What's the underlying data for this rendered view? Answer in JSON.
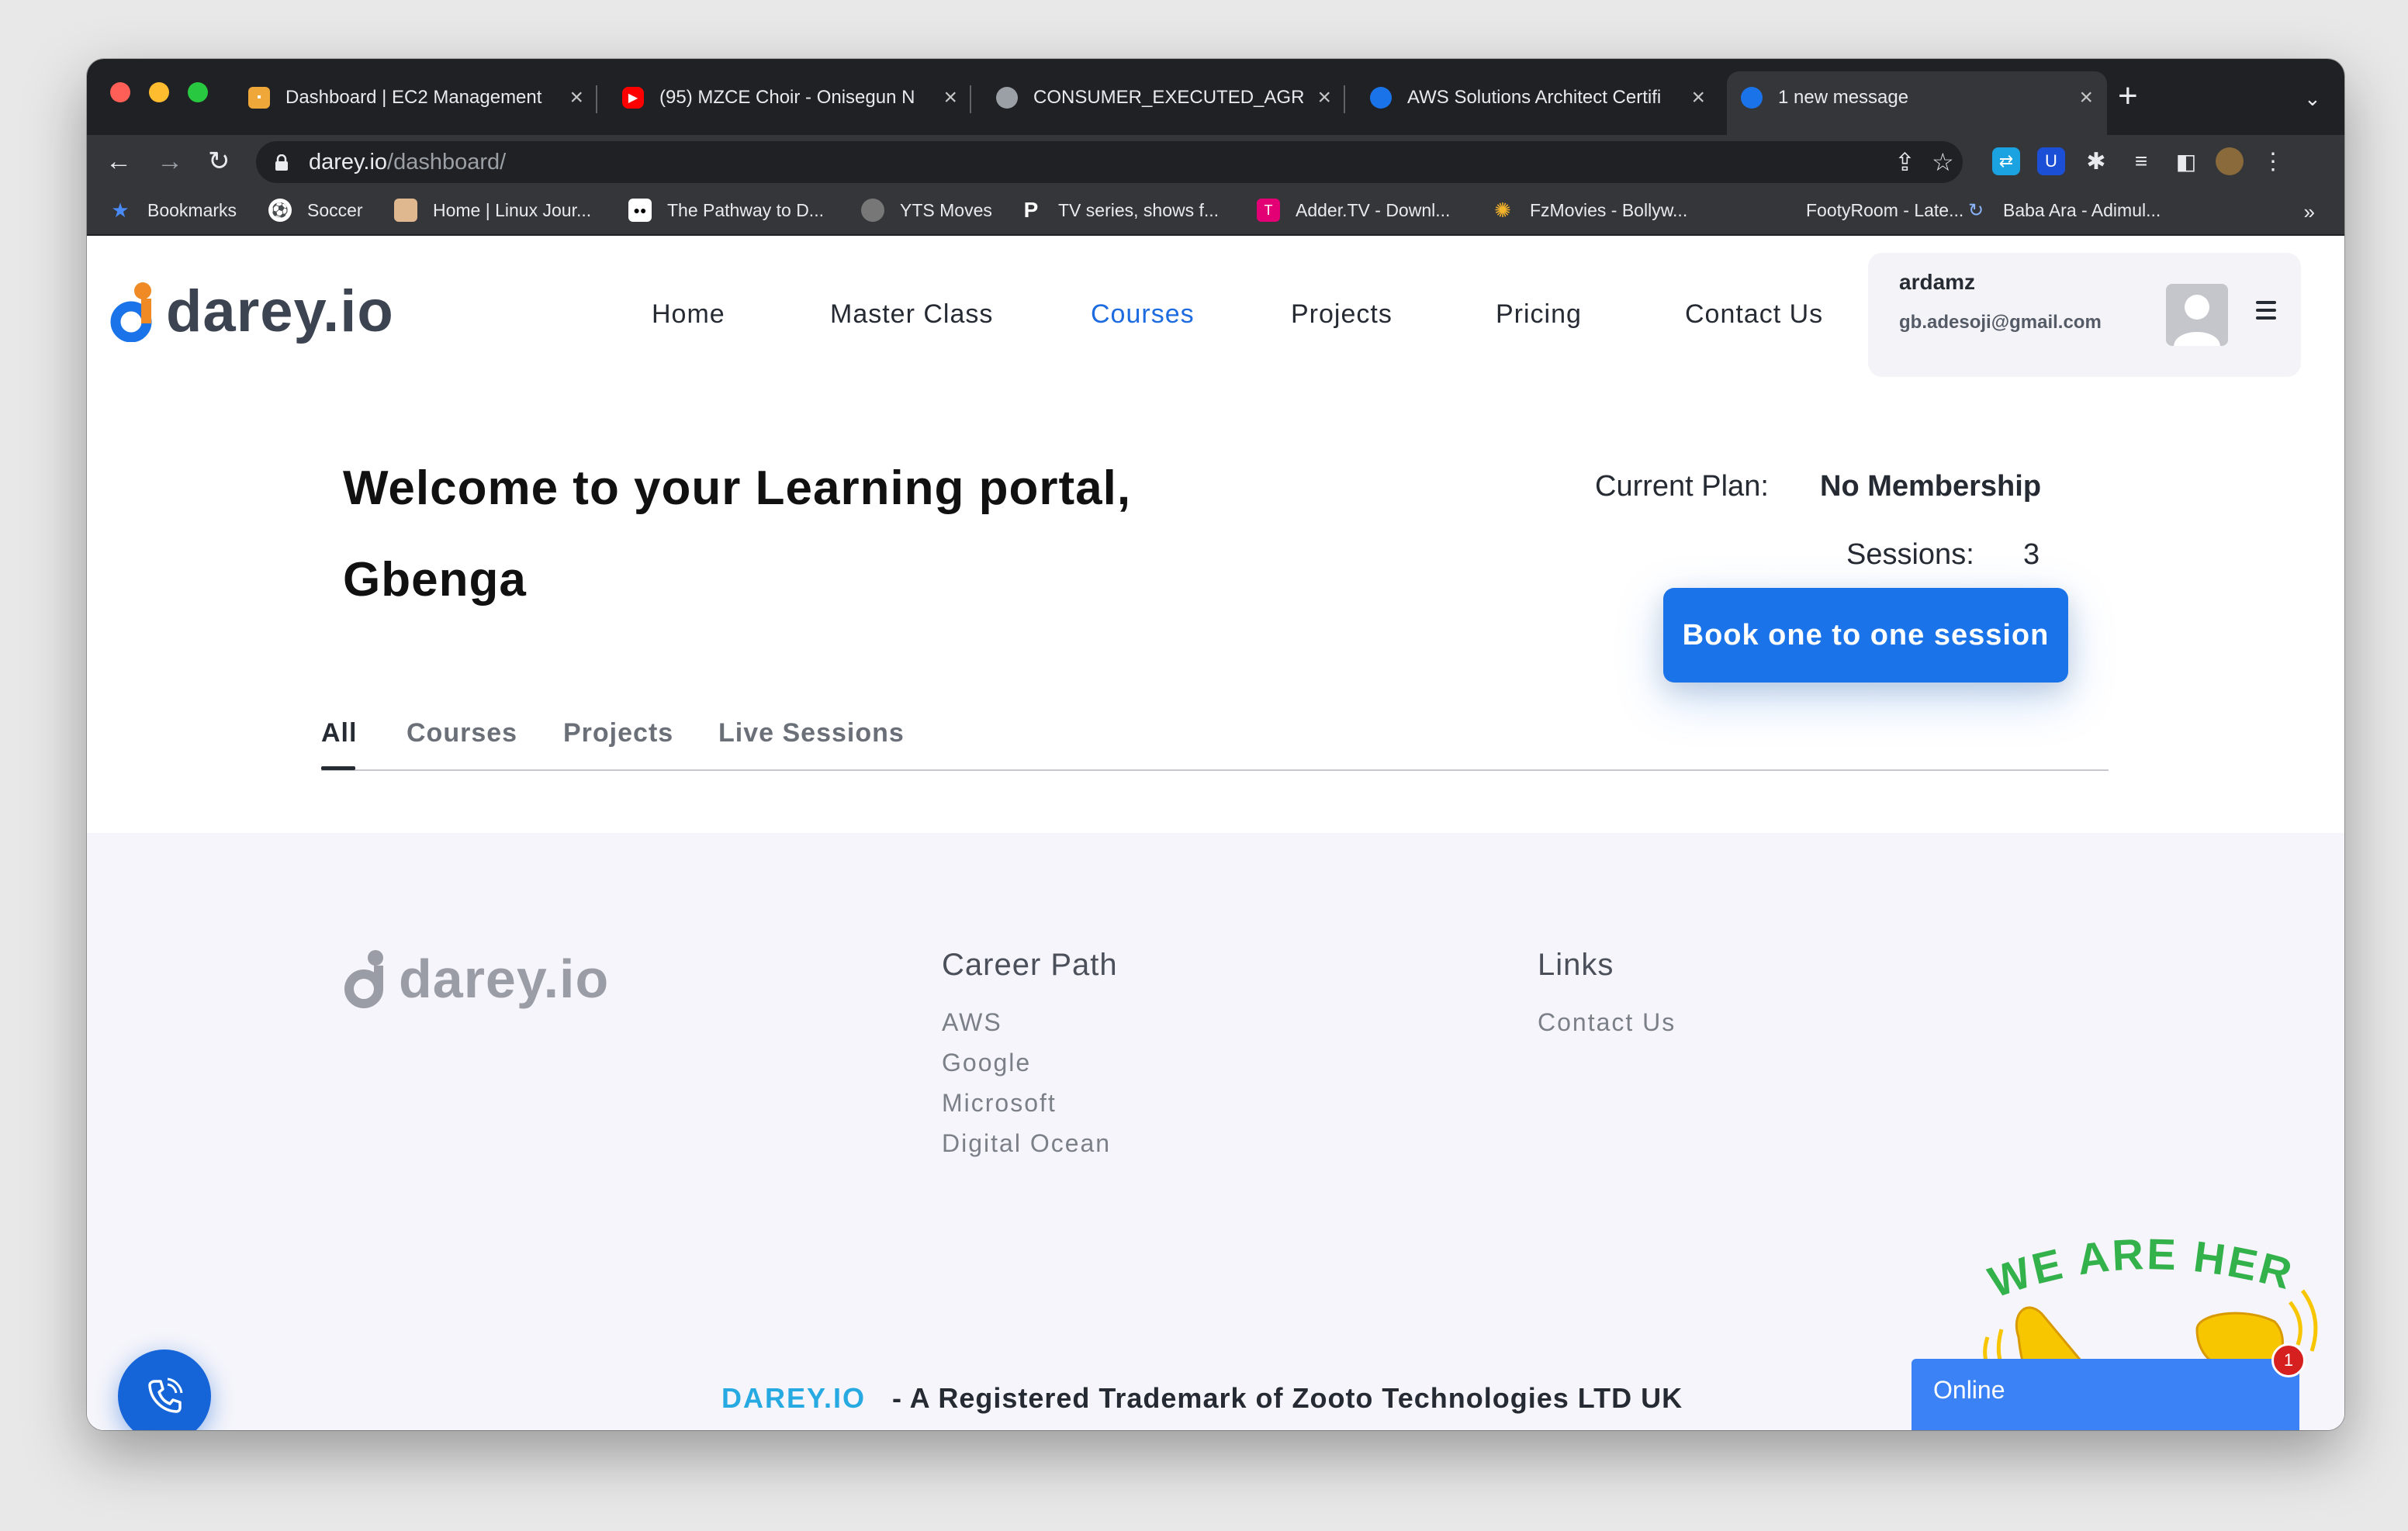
{
  "browser": {
    "tabs": [
      {
        "title": "Dashboard | EC2 Management",
        "favicon": "aws-box-icon",
        "color": "#f0a73a"
      },
      {
        "title": "(95) MZCE Choir - Onisegun N",
        "favicon": "youtube-icon",
        "color": "#ff0000"
      },
      {
        "title": "CONSUMER_EXECUTED_AGRE",
        "favicon": "globe-icon",
        "color": "#9aa0a6"
      },
      {
        "title": "AWS Solutions Architect Certifi",
        "favicon": "darey-icon",
        "color": "#1a73e8"
      },
      {
        "title": "1 new message",
        "favicon": "darey-icon",
        "color": "#1a73e8"
      }
    ],
    "url_domain": "darey.io",
    "url_path": "/dashboard/",
    "bookmarks": [
      {
        "label": "Bookmarks"
      },
      {
        "label": "Soccer"
      },
      {
        "label": "Home | Linux Jour..."
      },
      {
        "label": "The Pathway to D..."
      },
      {
        "label": "YTS Moves"
      },
      {
        "label": "TV series, shows f..."
      },
      {
        "label": "Adder.TV - Downl..."
      },
      {
        "label": "FzMovies - Bollyw..."
      },
      {
        "label": "FootyRoom - Late..."
      },
      {
        "label": "Baba Ara - Adimul..."
      }
    ],
    "bookmarks_more": "»"
  },
  "header": {
    "logo_text": "darey.io",
    "nav": [
      "Home",
      "Master Class",
      "Courses",
      "Projects",
      "Pricing",
      "Contact Us"
    ],
    "active_nav": "Courses",
    "user": {
      "name": "ardamz",
      "email": "gb.adesoji@gmail.com"
    }
  },
  "main": {
    "welcome_line1": "Welcome to your Learning portal,",
    "welcome_line2": "Gbenga",
    "plan_label": "Current Plan:",
    "plan_value": "No Membership",
    "sessions_label": "Sessions:",
    "sessions_value": "3",
    "book_button": "Book one to one session",
    "tabs": [
      "All",
      "Courses",
      "Projects",
      "Live Sessions"
    ],
    "active_tab": "All"
  },
  "footer": {
    "logo_text": "darey.io",
    "career_heading": "Career Path",
    "career_links": [
      "AWS",
      "Google",
      "Microsoft",
      "Digital Ocean"
    ],
    "links_heading": "Links",
    "links": [
      "Contact Us"
    ],
    "trademark_brand": "DAREY.IO",
    "trademark_text": "- A Registered Trademark of Zooto Technologies LTD UK"
  },
  "widgets": {
    "we_are_here": "WE ARE HERE!",
    "chat_status": "Online",
    "chat_badge": "1"
  },
  "colors": {
    "brand_blue": "#1a73e8",
    "brand_orange": "#f08a24",
    "footer_bg": "#f5f5fb",
    "chat_blue": "#3b82f6"
  }
}
